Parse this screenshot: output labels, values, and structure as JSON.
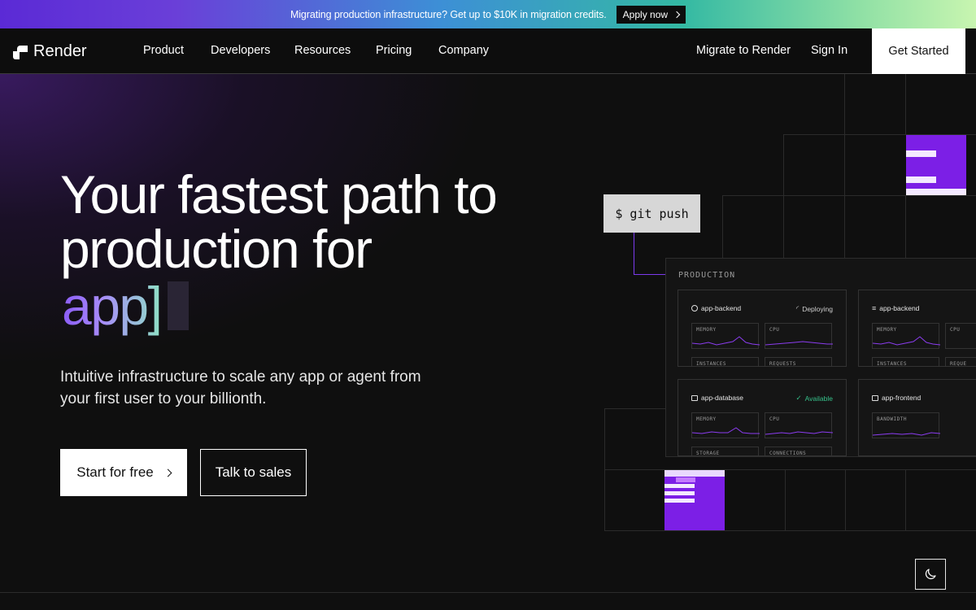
{
  "banner": {
    "text": "Migrating production infrastructure? Get up to $10K in migration credits.",
    "cta": "Apply now"
  },
  "nav": {
    "logo": "Render",
    "links": [
      "Product",
      "Developers",
      "Resources",
      "Pricing",
      "Company"
    ],
    "migrate": "Migrate to Render",
    "sign_in": "Sign In",
    "get_started": "Get Started"
  },
  "hero": {
    "headline_line1": "Your fastest path to",
    "headline_line2": "production for",
    "typed_word": "app]",
    "subtext": "Intuitive infrastructure to scale any app or agent from your first user to your billionth.",
    "primary_cta": "Start for free",
    "secondary_cta": "Talk to sales"
  },
  "illustration": {
    "command": "$ git push",
    "panel_title": "PRODUCTION",
    "cards": [
      {
        "name": "app-backend",
        "status": "Deploying",
        "metrics": [
          "MEMORY",
          "CPU"
        ],
        "bottom": [
          "INSTANCES",
          "REQUESTS"
        ]
      },
      {
        "name": "app-backend",
        "status": "",
        "metrics": [
          "MEMORY",
          "CPU"
        ],
        "bottom": [
          "INSTANCES",
          "REQUE"
        ]
      },
      {
        "name": "app-database",
        "status": "Available",
        "metrics": [
          "MEMORY",
          "CPU"
        ],
        "bottom": [
          "STORAGE",
          "CONNECTIONS"
        ]
      },
      {
        "name": "app-frontend",
        "status": "",
        "metrics": [
          "BANDWIDTH"
        ],
        "bottom": []
      }
    ]
  },
  "colors": {
    "accent_purple": "#7c1fe6",
    "status_ok": "#36c08a",
    "background": "#0f0f0f"
  },
  "icons": {
    "theme_toggle": "moon-icon"
  }
}
